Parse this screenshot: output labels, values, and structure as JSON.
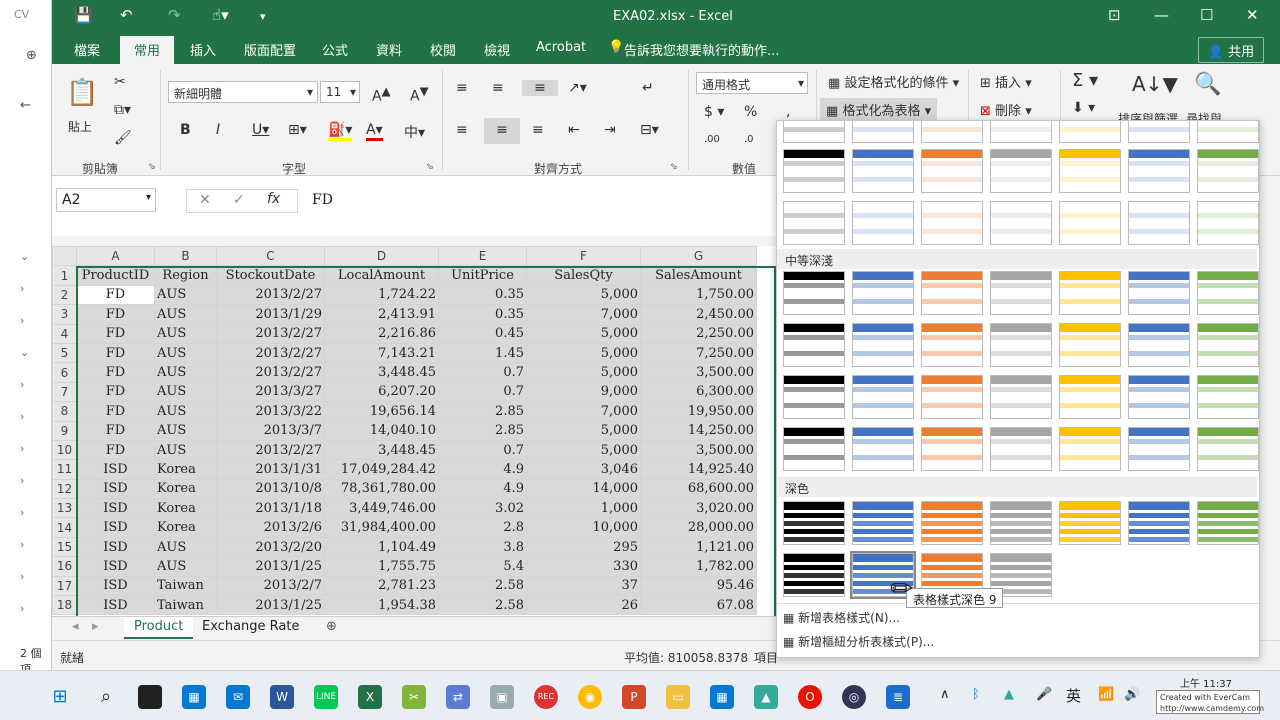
{
  "background_window": {
    "crumb": "CV",
    "status": "2 個項"
  },
  "titlebar": {
    "title": "EXA02.xlsx  -  Excel"
  },
  "tabs": [
    "檔案",
    "常用",
    "插入",
    "版面配置",
    "公式",
    "資料",
    "校閱",
    "檢視",
    "Acrobat"
  ],
  "tell_me": "告訴我您想要執行的動作...",
  "share": "共用",
  "ribbon": {
    "paste": "貼上",
    "font_name": "新細明體",
    "font_size": "11",
    "number_format": "通用格式",
    "cond_format": "設定格式化的條件",
    "format_as_table": "格式化為表格",
    "insert": "插入",
    "delete": "刪除",
    "sort_filter": "排序與篩選",
    "find_select": "尋找與",
    "groups": {
      "clipboard": "剪貼簿",
      "font": "字型",
      "alignment": "對齊方式",
      "number": "數值"
    }
  },
  "formula": {
    "namebox": "A2",
    "fx": "fx",
    "value": "FD"
  },
  "grid": {
    "columns": [
      "A",
      "B",
      "C",
      "D",
      "E",
      "F",
      "G"
    ],
    "rows": [
      [
        "1",
        "ProductID",
        "Region",
        "StockoutDate",
        "LocalAmount",
        "UnitPrice",
        "SalesQty",
        "SalesAmount"
      ],
      [
        "2",
        "FD",
        "AUS",
        "2013/2/27",
        "1,724.22",
        "0.35",
        "5,000",
        "1,750.00"
      ],
      [
        "3",
        "FD",
        "AUS",
        "2013/1/29",
        "2,413.91",
        "0.35",
        "7,000",
        "2,450.00"
      ],
      [
        "4",
        "FD",
        "AUS",
        "2013/2/27",
        "2,216.86",
        "0.45",
        "5,000",
        "2,250.00"
      ],
      [
        "5",
        "FD",
        "AUS",
        "2013/2/27",
        "7,143.21",
        "1.45",
        "5,000",
        "7,250.00"
      ],
      [
        "6",
        "FD",
        "AUS",
        "2013/2/27",
        "3,448.45",
        "0.7",
        "5,000",
        "3,500.00"
      ],
      [
        "7",
        "FD",
        "AUS",
        "2013/3/27",
        "6,207.20",
        "0.7",
        "9,000",
        "6,300.00"
      ],
      [
        "8",
        "FD",
        "AUS",
        "2013/3/22",
        "19,656.14",
        "2.85",
        "7,000",
        "19,950.00"
      ],
      [
        "9",
        "FD",
        "AUS",
        "2013/3/7",
        "14,040.10",
        "2.85",
        "5,000",
        "14,250.00"
      ],
      [
        "10",
        "FD",
        "AUS",
        "2013/2/27",
        "3,448.45",
        "0.7",
        "5,000",
        "3,500.00"
      ],
      [
        "11",
        "ISD",
        "Korea",
        "2013/1/31",
        "17,049,284.42",
        "4.9",
        "3,046",
        "14,925.40"
      ],
      [
        "12",
        "ISD",
        "Korea",
        "2013/10/8",
        "78,361,780.00",
        "4.9",
        "14,000",
        "68,600.00"
      ],
      [
        "13",
        "ISD",
        "Korea",
        "2013/1/18",
        "3,449,746.00",
        "3.02",
        "1,000",
        "3,020.00"
      ],
      [
        "14",
        "ISD",
        "Korea",
        "2013/2/6",
        "31,984,400.00",
        "2.8",
        "10,000",
        "28,000.00"
      ],
      [
        "15",
        "ISD",
        "AUS",
        "2013/2/20",
        "1,104.49",
        "3.8",
        "295",
        "1,121.00"
      ],
      [
        "16",
        "ISD",
        "AUS",
        "2013/1/25",
        "1,755.75",
        "5.4",
        "330",
        "1,782.00"
      ],
      [
        "17",
        "ISD",
        "Taiwan",
        "2013/2/7",
        "2,781.23",
        "2.58",
        "37",
        "95.46"
      ],
      [
        "18",
        "ISD",
        "Taiwan",
        "2013/1/25",
        "1,954.38",
        "2.58",
        "26",
        "67.08"
      ]
    ]
  },
  "sheet_tabs": [
    "Product",
    "Exchange Rate"
  ],
  "status": {
    "ready": "就緒",
    "average": "平均值: 810058.8378",
    "count_label": "項目"
  },
  "gallery": {
    "sections": [
      "中等深淺",
      "深色"
    ],
    "tooltip": "表格樣式深色 9",
    "new_table_style": "新增表格樣式(N)...",
    "new_pivot_style": "新增樞紐分析表樣式(P)...",
    "colors": [
      "#000000",
      "#4472c4",
      "#ed7d31",
      "#a5a5a5",
      "#ffc000",
      "#4472c4",
      "#70ad47"
    ]
  },
  "taskbar": {
    "time": "上午 11:37",
    "ime": "英",
    "watermark": "Created with EverCam http://www.camdemy.com"
  }
}
